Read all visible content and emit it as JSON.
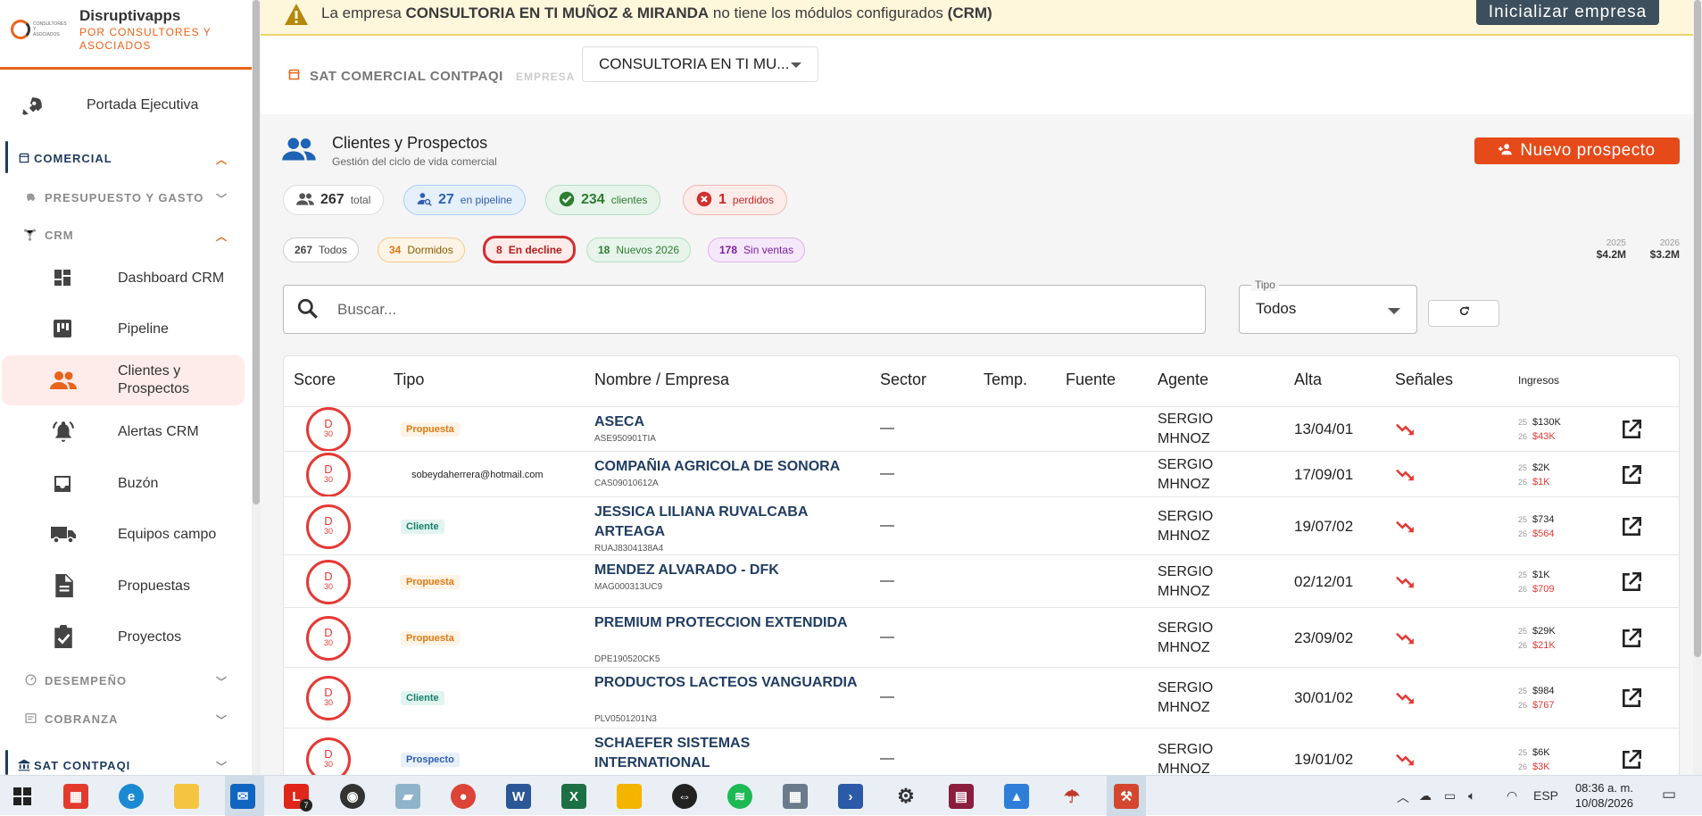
{
  "brand": {
    "name": "Disruptivapps",
    "subtitle": "POR CONSULTORES Y ASOCIADOS"
  },
  "sidebar": {
    "portada": "Portada Ejecutiva",
    "sections": {
      "comercial": "COMERCIAL",
      "presupuesto": "PRESUPUESTO Y GASTO",
      "crm": "CRM",
      "desempeno": "DESEMPEÑO",
      "cobranza": "COBRANZA",
      "sat": "SAT CONTPAQI"
    },
    "items": {
      "dashboard": "Dashboard CRM",
      "pipeline": "Pipeline",
      "clientes": "Clientes y Prospectos",
      "alertas": "Alertas CRM",
      "buzon": "Buzón",
      "equipos": "Equipos campo",
      "propuestas": "Propuestas",
      "proyectos": "Proyectos"
    }
  },
  "warning": {
    "prefix": "La empresa",
    "company": "CONSULTORIA EN TI MUÑOZ & MIRANDA",
    "middle": "no tiene los módulos configurados",
    "module": "(CRM)",
    "button": "Inicializar empresa"
  },
  "topbar": {
    "sat_label": "SAT COMERCIAL CONTPAQI",
    "empresa_label": "EMPRESA",
    "empresa_value": "CONSULTORIA EN TI MU..."
  },
  "page": {
    "title": "Clientes y Prospectos",
    "subtitle": "Gestión del ciclo de vida comercial",
    "new_button": "Nuevo prospecto"
  },
  "stats": [
    {
      "num": "267",
      "label": "total"
    },
    {
      "num": "27",
      "label": "en pipeline"
    },
    {
      "num": "234",
      "label": "clientes"
    },
    {
      "num": "1",
      "label": "perdidos"
    }
  ],
  "filters": [
    {
      "num": "267",
      "label": "Todos"
    },
    {
      "num": "34",
      "label": "Dormidos"
    },
    {
      "num": "8",
      "label": "En decline"
    },
    {
      "num": "18",
      "label": "Nuevos 2026"
    },
    {
      "num": "178",
      "label": "Sin ventas"
    }
  ],
  "year_totals": [
    {
      "year": "2025",
      "value": "$4.2M"
    },
    {
      "year": "2026",
      "value": "$3.2M"
    }
  ],
  "search": {
    "placeholder": "Buscar..."
  },
  "tipo": {
    "label": "Tipo",
    "value": "Todos"
  },
  "table": {
    "headers": {
      "score": "Score",
      "tipo": "Tipo",
      "nombre": "Nombre / Empresa",
      "sector": "Sector",
      "temp": "Temp.",
      "fuente": "Fuente",
      "agente": "Agente",
      "alta": "Alta",
      "senales": "Señales",
      "ingresos": "Ingresos"
    },
    "rows": [
      {
        "score": "D",
        "score_n": "30",
        "tipo": "Propuesta",
        "name": "ASECA",
        "rfc": "ASE950901TIA",
        "sector": "—",
        "agent1": "SERGIO",
        "agent2": "MHNOZ",
        "alta": "13/04/01",
        "y1": "25",
        "v1": "$130K",
        "y2": "26",
        "v2": "$43K"
      },
      {
        "score": "D",
        "score_n": "30",
        "tipo": "sobeydaherrera@hotmail.com",
        "name": "COMPAÑIA AGRICOLA DE SONORA",
        "rfc": "CAS09010612A",
        "sector": "—",
        "agent1": "SERGIO",
        "agent2": "MHNOZ",
        "alta": "17/09/01",
        "y1": "25",
        "v1": "$2K",
        "y2": "26",
        "v2": "$1K"
      },
      {
        "score": "D",
        "score_n": "30",
        "tipo": "Cliente",
        "name": "JESSICA LILIANA RUVALCABA ARTEAGA",
        "rfc": "RUAJ8304138A4",
        "sector": "—",
        "agent1": "SERGIO",
        "agent2": "MHNOZ",
        "alta": "19/07/02",
        "y1": "25",
        "v1": "$734",
        "y2": "26",
        "v2": "$564"
      },
      {
        "score": "D",
        "score_n": "30",
        "tipo": "Propuesta",
        "name": "MENDEZ ALVARADO - DFK",
        "rfc": "MAG000313UC9",
        "sector": "—",
        "agent1": "SERGIO",
        "agent2": "MHNOZ",
        "alta": "02/12/01",
        "y1": "25",
        "v1": "$1K",
        "y2": "26",
        "v2": "$709"
      },
      {
        "score": "D",
        "score_n": "30",
        "tipo": "Propuesta",
        "name": "PREMIUM PROTECCION EXTENDIDA",
        "rfc": "DPE190520CK5",
        "sector": "—",
        "agent1": "SERGIO",
        "agent2": "MHNOZ",
        "alta": "23/09/02",
        "y1": "25",
        "v1": "$29K",
        "y2": "26",
        "v2": "$21K"
      },
      {
        "score": "D",
        "score_n": "30",
        "tipo": "Cliente",
        "name": "PRODUCTOS LACTEOS VANGUARDIA",
        "rfc": "PLV0501201N3",
        "sector": "—",
        "agent1": "SERGIO",
        "agent2": "MHNOZ",
        "alta": "30/01/02",
        "y1": "25",
        "v1": "$984",
        "y2": "26",
        "v2": "$767"
      },
      {
        "score": "D",
        "score_n": "30",
        "tipo": "Prospecto",
        "name": "SCHAEFER SISTEMAS INTERNATIONAL",
        "rfc": "",
        "sector": "—",
        "agent1": "SERGIO",
        "agent2": "MHNOZ",
        "alta": "19/01/02",
        "y1": "25",
        "v1": "$6K",
        "y2": "26",
        "v2": "$3K"
      }
    ]
  },
  "taskbar": {
    "lang": "ESP",
    "time": "08:36 a. m.",
    "date": "10/08/2026",
    "badge": "7"
  },
  "colors": {
    "accent": "#e8641a",
    "primary_button": "#e64a19",
    "danger": "#e53935",
    "link": "#213d63"
  }
}
